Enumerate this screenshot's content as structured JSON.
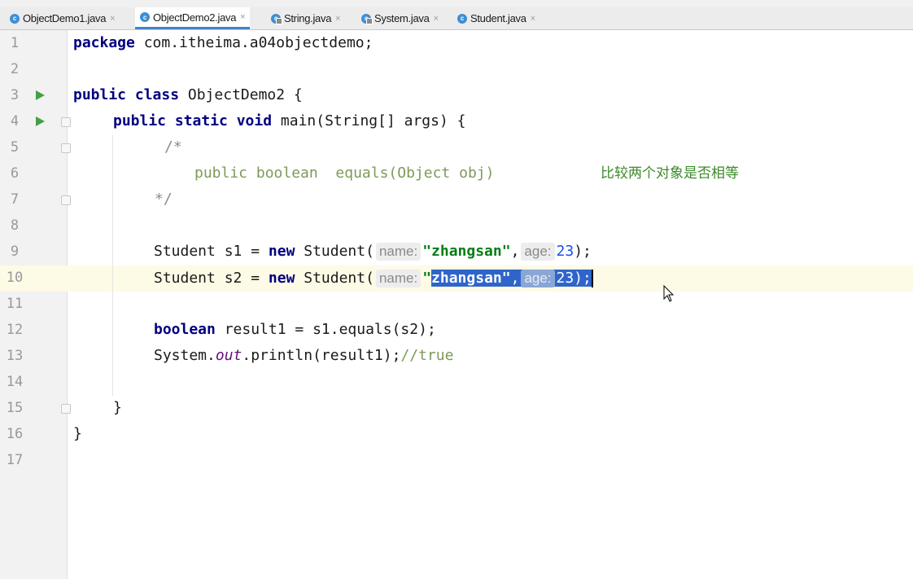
{
  "tabs": [
    {
      "label": "ObjectDemo1.java",
      "icon": "c-class-icon",
      "active": false
    },
    {
      "label": "ObjectDemo2.java",
      "icon": "c-class-icon",
      "active": true
    },
    {
      "label": "String.java",
      "icon": "library-class-icon",
      "active": false
    },
    {
      "label": "System.java",
      "icon": "library-class-icon",
      "active": false
    },
    {
      "label": "Student.java",
      "icon": "c-class-icon",
      "active": false
    }
  ],
  "close_glyph": "×",
  "line_numbers": [
    "1",
    "2",
    "3",
    "4",
    "5",
    "6",
    "7",
    "8",
    "9",
    "10",
    "11",
    "12",
    "13",
    "14",
    "15",
    "16",
    "17"
  ],
  "current_line": "10",
  "code": {
    "l1_kw": "package",
    "l1_rest": " com.itheima.a04objectdemo;",
    "l3_kw": "public class",
    "l3_rest": " ObjectDemo2 {",
    "l4_kw": "public static void",
    "l4_rest": " main(String[] args) {",
    "l5": "/*",
    "l6_code": "public boolean  equals(Object obj)",
    "l6_note": "比较两个对象是否相等",
    "l7": "*/",
    "l9_a": "Student s1 = ",
    "l9_kw": "new",
    "l9_b": " Student(",
    "hint_name": "name:",
    "l9_str": "\"zhangsan\"",
    "comma": ",",
    "hint_age": "age:",
    "l9_num": "23",
    "l9_end": ");",
    "l10_a": "Student s2 = ",
    "l10_kw": "new",
    "l10_b": " Student(",
    "l10_q": "\"",
    "l10_sel_str": "zhangsan\"",
    "l10_num": "23",
    "l10_end": ");",
    "l12_kw": "boolean",
    "l12_rest": " result1 = s1.equals(s2);",
    "l13_a": "System.",
    "l13_field": "out",
    "l13_b": ".println(result1);",
    "l13_comment": "//true",
    "l15": "}",
    "l16": "}"
  },
  "colors": {
    "keyword": "#000080",
    "string": "#067d17",
    "number": "#1750eb",
    "selection": "#2f65ca",
    "current_line_bg": "#fdfae6",
    "run_marker": "#43a047"
  }
}
